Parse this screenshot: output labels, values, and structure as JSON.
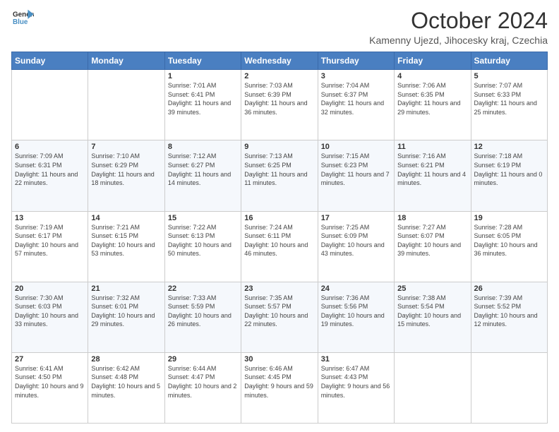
{
  "header": {
    "logo_line1": "General",
    "logo_line2": "Blue",
    "title": "October 2024",
    "subtitle": "Kamenny Ujezd, Jihocesky kraj, Czechia"
  },
  "days_of_week": [
    "Sunday",
    "Monday",
    "Tuesday",
    "Wednesday",
    "Thursday",
    "Friday",
    "Saturday"
  ],
  "weeks": [
    [
      {
        "day": "",
        "info": ""
      },
      {
        "day": "",
        "info": ""
      },
      {
        "day": "1",
        "info": "Sunrise: 7:01 AM\nSunset: 6:41 PM\nDaylight: 11 hours and 39 minutes."
      },
      {
        "day": "2",
        "info": "Sunrise: 7:03 AM\nSunset: 6:39 PM\nDaylight: 11 hours and 36 minutes."
      },
      {
        "day": "3",
        "info": "Sunrise: 7:04 AM\nSunset: 6:37 PM\nDaylight: 11 hours and 32 minutes."
      },
      {
        "day": "4",
        "info": "Sunrise: 7:06 AM\nSunset: 6:35 PM\nDaylight: 11 hours and 29 minutes."
      },
      {
        "day": "5",
        "info": "Sunrise: 7:07 AM\nSunset: 6:33 PM\nDaylight: 11 hours and 25 minutes."
      }
    ],
    [
      {
        "day": "6",
        "info": "Sunrise: 7:09 AM\nSunset: 6:31 PM\nDaylight: 11 hours and 22 minutes."
      },
      {
        "day": "7",
        "info": "Sunrise: 7:10 AM\nSunset: 6:29 PM\nDaylight: 11 hours and 18 minutes."
      },
      {
        "day": "8",
        "info": "Sunrise: 7:12 AM\nSunset: 6:27 PM\nDaylight: 11 hours and 14 minutes."
      },
      {
        "day": "9",
        "info": "Sunrise: 7:13 AM\nSunset: 6:25 PM\nDaylight: 11 hours and 11 minutes."
      },
      {
        "day": "10",
        "info": "Sunrise: 7:15 AM\nSunset: 6:23 PM\nDaylight: 11 hours and 7 minutes."
      },
      {
        "day": "11",
        "info": "Sunrise: 7:16 AM\nSunset: 6:21 PM\nDaylight: 11 hours and 4 minutes."
      },
      {
        "day": "12",
        "info": "Sunrise: 7:18 AM\nSunset: 6:19 PM\nDaylight: 11 hours and 0 minutes."
      }
    ],
    [
      {
        "day": "13",
        "info": "Sunrise: 7:19 AM\nSunset: 6:17 PM\nDaylight: 10 hours and 57 minutes."
      },
      {
        "day": "14",
        "info": "Sunrise: 7:21 AM\nSunset: 6:15 PM\nDaylight: 10 hours and 53 minutes."
      },
      {
        "day": "15",
        "info": "Sunrise: 7:22 AM\nSunset: 6:13 PM\nDaylight: 10 hours and 50 minutes."
      },
      {
        "day": "16",
        "info": "Sunrise: 7:24 AM\nSunset: 6:11 PM\nDaylight: 10 hours and 46 minutes."
      },
      {
        "day": "17",
        "info": "Sunrise: 7:25 AM\nSunset: 6:09 PM\nDaylight: 10 hours and 43 minutes."
      },
      {
        "day": "18",
        "info": "Sunrise: 7:27 AM\nSunset: 6:07 PM\nDaylight: 10 hours and 39 minutes."
      },
      {
        "day": "19",
        "info": "Sunrise: 7:28 AM\nSunset: 6:05 PM\nDaylight: 10 hours and 36 minutes."
      }
    ],
    [
      {
        "day": "20",
        "info": "Sunrise: 7:30 AM\nSunset: 6:03 PM\nDaylight: 10 hours and 33 minutes."
      },
      {
        "day": "21",
        "info": "Sunrise: 7:32 AM\nSunset: 6:01 PM\nDaylight: 10 hours and 29 minutes."
      },
      {
        "day": "22",
        "info": "Sunrise: 7:33 AM\nSunset: 5:59 PM\nDaylight: 10 hours and 26 minutes."
      },
      {
        "day": "23",
        "info": "Sunrise: 7:35 AM\nSunset: 5:57 PM\nDaylight: 10 hours and 22 minutes."
      },
      {
        "day": "24",
        "info": "Sunrise: 7:36 AM\nSunset: 5:56 PM\nDaylight: 10 hours and 19 minutes."
      },
      {
        "day": "25",
        "info": "Sunrise: 7:38 AM\nSunset: 5:54 PM\nDaylight: 10 hours and 15 minutes."
      },
      {
        "day": "26",
        "info": "Sunrise: 7:39 AM\nSunset: 5:52 PM\nDaylight: 10 hours and 12 minutes."
      }
    ],
    [
      {
        "day": "27",
        "info": "Sunrise: 6:41 AM\nSunset: 4:50 PM\nDaylight: 10 hours and 9 minutes."
      },
      {
        "day": "28",
        "info": "Sunrise: 6:42 AM\nSunset: 4:48 PM\nDaylight: 10 hours and 5 minutes."
      },
      {
        "day": "29",
        "info": "Sunrise: 6:44 AM\nSunset: 4:47 PM\nDaylight: 10 hours and 2 minutes."
      },
      {
        "day": "30",
        "info": "Sunrise: 6:46 AM\nSunset: 4:45 PM\nDaylight: 9 hours and 59 minutes."
      },
      {
        "day": "31",
        "info": "Sunrise: 6:47 AM\nSunset: 4:43 PM\nDaylight: 9 hours and 56 minutes."
      },
      {
        "day": "",
        "info": ""
      },
      {
        "day": "",
        "info": ""
      }
    ]
  ]
}
